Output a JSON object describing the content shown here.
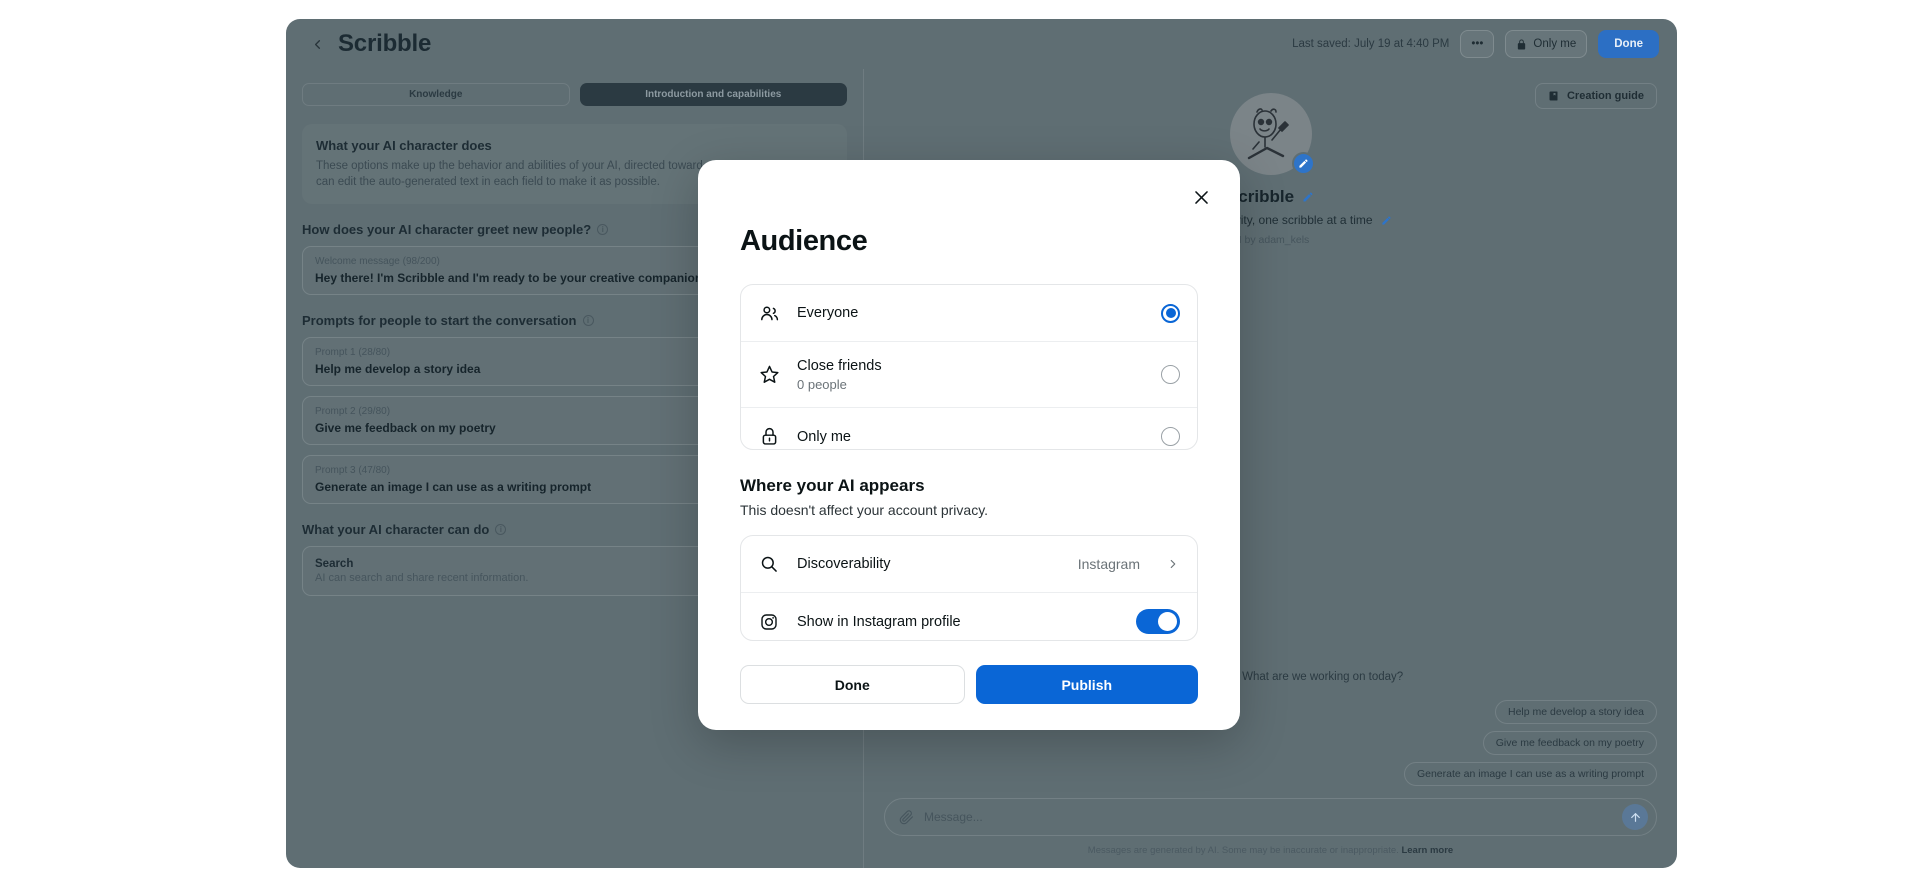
{
  "app": {
    "title": "Scribble",
    "back_icon": "chevron-left-icon",
    "last_saved": "Last saved: July 19 at 4:40 PM",
    "more_label": "•••",
    "privacy_label": "Only me",
    "privacy_icon": "lock-icon",
    "done_label": "Done"
  },
  "tabs": [
    {
      "label": "Knowledge",
      "active": false
    },
    {
      "label": "Introduction and capabilities",
      "active": true
    }
  ],
  "left_panel": {
    "intro": {
      "heading": "What your AI character does",
      "body": "These options make up the behavior and abilities of your AI, directed toward people in a chat. You can edit the auto-generated text in each field to make it as possible."
    },
    "greeting_section": {
      "title": "How does your AI character greet new people?",
      "field_label": "Welcome message (98/200)",
      "field_value": "Hey there! I'm Scribble and I'm ready to be your creative companion."
    },
    "prompts_section": {
      "title": "Prompts for people to start the conversation",
      "prompts": [
        {
          "label": "Prompt 1 (28/80)",
          "value": "Help me develop a story idea"
        },
        {
          "label": "Prompt 2 (29/80)",
          "value": "Give me feedback on my poetry"
        },
        {
          "label": "Prompt 3 (47/80)",
          "value": "Generate an image I can use as a writing prompt"
        }
      ]
    },
    "capabilities_section": {
      "title": "What your AI character can do",
      "items": [
        {
          "title": "Search",
          "subtitle": "AI can search and share recent information."
        }
      ]
    }
  },
  "right_panel": {
    "guide_label": "Creation guide",
    "guide_icon": "book-icon",
    "avatar_edit_icon": "pencil-icon",
    "name": "Scribble",
    "name_edit_icon": "pencil-icon",
    "tagline": "Unlocking creativity, one scribble at a time",
    "tagline_edit_icon": "pencil-icon",
    "byline": "AI by adam_kels",
    "chat_message": "Hey there! I'm Scribble and I'm ready to be your creative companion. What are we working on today?",
    "suggestion_chips": [
      "Help me develop a story idea",
      "Give me feedback on my poetry",
      "Generate an image I can use as a writing prompt"
    ],
    "composer_placeholder": "Message...",
    "attach_icon": "paperclip-icon",
    "send_icon": "arrow-up-icon",
    "disclaimer": "Messages are generated by AI. Some may be inaccurate or inappropriate.",
    "disclaimer_link": "Learn more"
  },
  "modal": {
    "title": "Audience",
    "close_icon": "close-icon",
    "audience_options": [
      {
        "icon": "people-icon",
        "label": "Everyone",
        "sub": "",
        "selected": true
      },
      {
        "icon": "star-icon",
        "label": "Close friends",
        "sub": "0 people",
        "selected": false
      },
      {
        "icon": "lock-icon",
        "label": "Only me",
        "sub": "",
        "selected": false
      }
    ],
    "appears_heading": "Where your AI appears",
    "appears_subtext": "This doesn't affect your account privacy.",
    "appears_rows": {
      "discoverability": {
        "icon": "search-icon",
        "label": "Discoverability",
        "value": "Instagram",
        "chevron_icon": "chevron-right-icon"
      },
      "show_in_profile": {
        "icon": "instagram-icon",
        "label": "Show in Instagram profile",
        "toggle_on": true
      }
    },
    "done_label": "Done",
    "publish_label": "Publish"
  },
  "colors": {
    "accent": "#0a66d6",
    "app_bg": "#5f6e73",
    "modal_bg": "#ffffff"
  }
}
